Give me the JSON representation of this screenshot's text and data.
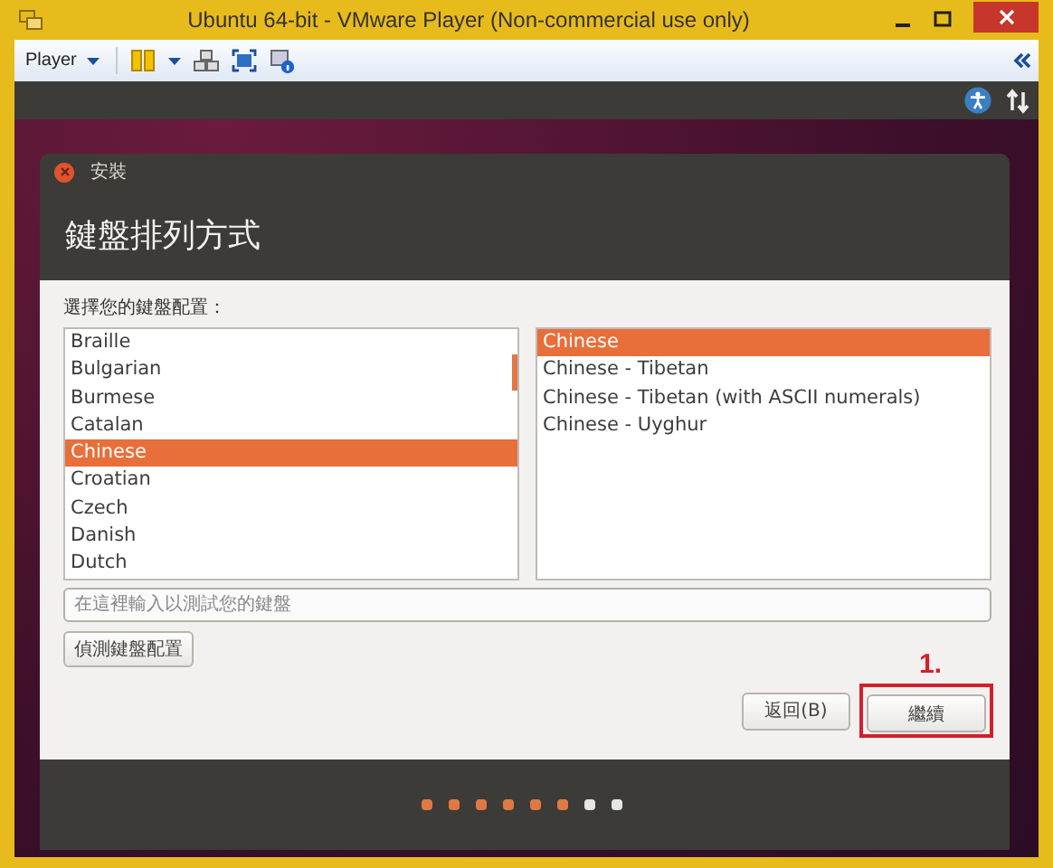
{
  "window": {
    "title": "Ubuntu 64-bit - VMware Player (Non-commercial use only)"
  },
  "toolbar": {
    "player_menu": "Player"
  },
  "dialog": {
    "title": "安裝",
    "heading": "鍵盤排列方式",
    "prompt": "選擇您的鍵盤配置：",
    "layouts": [
      {
        "label": "Braille",
        "selected": false
      },
      {
        "label": "Bulgarian",
        "selected": false
      },
      {
        "label": "Burmese",
        "selected": false
      },
      {
        "label": "Catalan",
        "selected": false
      },
      {
        "label": "Chinese",
        "selected": true
      },
      {
        "label": "Croatian",
        "selected": false
      },
      {
        "label": "Czech",
        "selected": false
      },
      {
        "label": "Danish",
        "selected": false
      },
      {
        "label": "Dutch",
        "selected": false
      }
    ],
    "variants": [
      {
        "label": "Chinese",
        "selected": true
      },
      {
        "label": "Chinese - Tibetan",
        "selected": false
      },
      {
        "label": "Chinese - Tibetan (with ASCII numerals)",
        "selected": false
      },
      {
        "label": "Chinese - Uyghur",
        "selected": false
      }
    ],
    "test_field": {
      "placeholder": "在這裡輸入以測試您的鍵盤"
    },
    "detect_button": "偵測鍵盤配置",
    "back_button": "返回(B)",
    "continue_button": "繼續",
    "annotation": "1.",
    "steps": [
      {
        "done": true
      },
      {
        "done": true
      },
      {
        "done": true
      },
      {
        "done": true
      },
      {
        "done": true
      },
      {
        "done": true
      },
      {
        "done": false
      },
      {
        "done": false
      }
    ]
  }
}
